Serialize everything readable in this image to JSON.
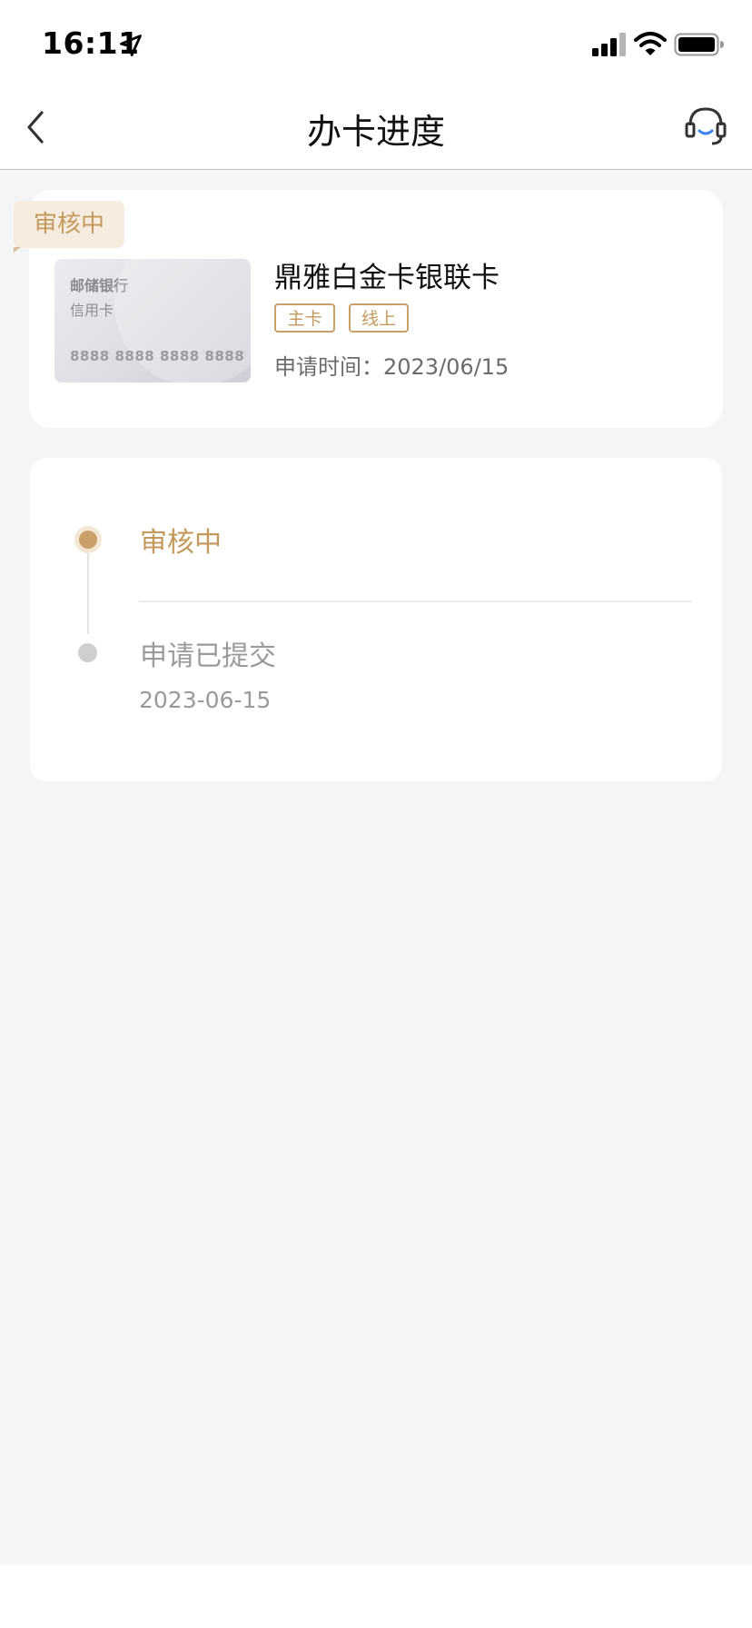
{
  "status_bar": {
    "time": "16:11",
    "icons": [
      "location-arrow-icon",
      "cellular-signal-icon",
      "wifi-icon",
      "battery-icon"
    ]
  },
  "nav": {
    "title": "办卡进度",
    "back_icon": "chevron-left-icon",
    "service_icon": "headset-icon"
  },
  "card": {
    "status_badge": "审核中",
    "thumb": {
      "bank": "邮储银行",
      "type": "信用卡",
      "number": "8888 8888 8888 8888"
    },
    "name": "鼎雅白金卡银联卡",
    "tags": [
      "主卡",
      "线上"
    ],
    "apply_time": "申请时间：2023/06/15"
  },
  "progress": {
    "steps": [
      {
        "label": "审核中",
        "date": "",
        "state": "active"
      },
      {
        "label": "申请已提交",
        "date": "2023-06-15",
        "state": "done"
      }
    ]
  },
  "colors": {
    "accent": "#c49a5c",
    "accent_light": "#f6ecdf",
    "muted": "#9a9a9a",
    "background": "#f5f5f5"
  }
}
